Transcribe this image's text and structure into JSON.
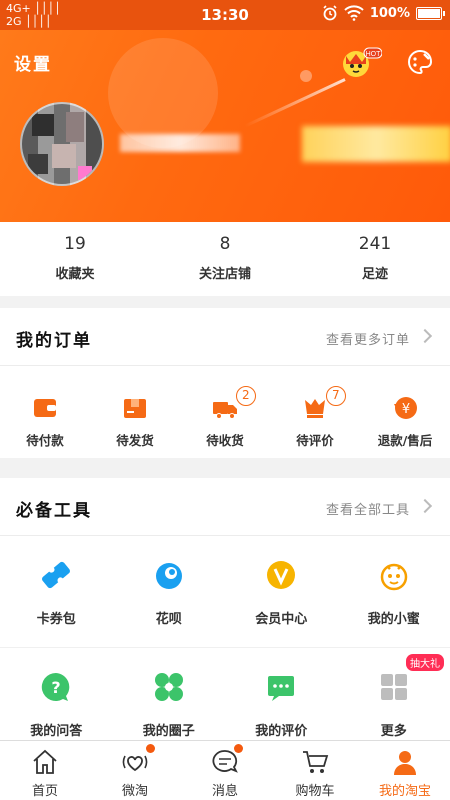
{
  "status_bar": {
    "signal_top": "4G+ ││││",
    "signal_bottom": "2G  ││││",
    "time": "13:30",
    "battery": "100%"
  },
  "header": {
    "settings_label": "设置",
    "hot_label": "HOT"
  },
  "stats": [
    {
      "value": "19",
      "label": "收藏夹"
    },
    {
      "value": "8",
      "label": "关注店铺"
    },
    {
      "value": "241",
      "label": "足迹"
    }
  ],
  "orders": {
    "title": "我的订单",
    "more": "查看更多订单",
    "items": [
      {
        "label": "待付款",
        "icon": "wallet-icon",
        "badge": ""
      },
      {
        "label": "待发货",
        "icon": "package-icon",
        "badge": ""
      },
      {
        "label": "待收货",
        "icon": "truck-icon",
        "badge": "2"
      },
      {
        "label": "待评价",
        "icon": "comment-icon",
        "badge": "7"
      },
      {
        "label": "退款/售后",
        "icon": "refund-icon",
        "badge": ""
      }
    ]
  },
  "tools": {
    "title": "必备工具",
    "more": "查看全部工具",
    "items": [
      {
        "label": "卡券包",
        "icon": "coupon-icon"
      },
      {
        "label": "花呗",
        "icon": "huabei-icon"
      },
      {
        "label": "会员中心",
        "icon": "vip-icon"
      },
      {
        "label": "我的小蜜",
        "icon": "assistant-icon"
      },
      {
        "label": "我的问答",
        "icon": "question-icon"
      },
      {
        "label": "我的圈子",
        "icon": "circle-icon"
      },
      {
        "label": "我的评价",
        "icon": "review-icon"
      },
      {
        "label": "更多",
        "icon": "more-grid-icon"
      }
    ],
    "gift_badge": "抽大礼"
  },
  "tabbar": [
    {
      "label": "首页",
      "icon": "home-icon",
      "dot": false
    },
    {
      "label": "微淘",
      "icon": "weitao-icon",
      "dot": true
    },
    {
      "label": "消息",
      "icon": "message-icon",
      "dot": true
    },
    {
      "label": "购物车",
      "icon": "cart-icon",
      "dot": false
    },
    {
      "label": "我的淘宝",
      "icon": "profile-icon",
      "dot": false,
      "active": true
    }
  ],
  "colors": {
    "accent": "#f56a15",
    "header": "#ff6a10"
  }
}
